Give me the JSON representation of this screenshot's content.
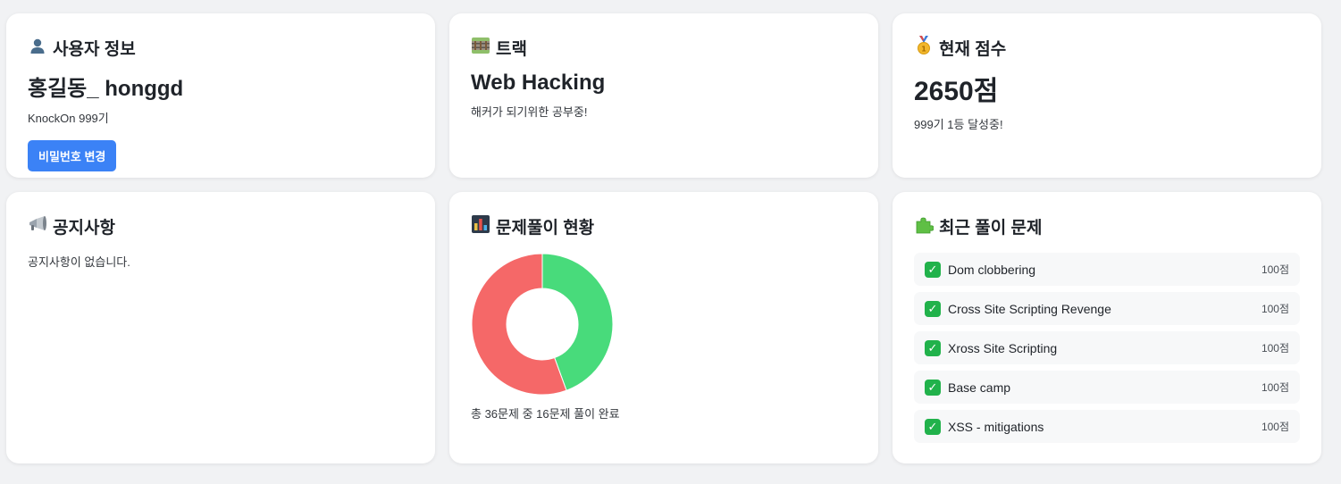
{
  "user_card": {
    "icon": "user-icon",
    "title": "사용자 정보",
    "name": "홍길동_ honggd",
    "generation": "KnockOn 999기",
    "change_password_label": "비밀번호 변경",
    "accent_color": "#3b82f6"
  },
  "track_card": {
    "icon": "railway-track-icon",
    "title": "트랙",
    "track": "Web Hacking",
    "description": "해커가 되기위한 공부중!"
  },
  "score_card": {
    "icon": "medal-icon",
    "title": "현재 점수",
    "score": "2650점",
    "rank_text": "999기 1등 달성중!"
  },
  "notice_card": {
    "icon": "megaphone-icon",
    "title": "공지사항",
    "empty_text": "공지사항이 없습니다."
  },
  "progress_card": {
    "icon": "bar-chart-icon",
    "title": "문제풀이 현황",
    "caption": "총 36문제 중 16문제 풀이 완료"
  },
  "chart_data": {
    "type": "pie",
    "donut": true,
    "categories": [
      "solved",
      "unsolved"
    ],
    "values": [
      16,
      20
    ],
    "colors": [
      "#48db7b",
      "#f56868"
    ]
  },
  "recent_card": {
    "icon": "puzzle-icon",
    "title": "최근 풀이 문제",
    "check_icon": "check-icon",
    "check_color": "#21b24b",
    "items": [
      {
        "title": "Dom clobbering",
        "score": "100점"
      },
      {
        "title": "Cross Site Scripting Revenge",
        "score": "100점"
      },
      {
        "title": "Xross Site Scripting",
        "score": "100점"
      },
      {
        "title": "Base camp",
        "score": "100점"
      },
      {
        "title": "XSS - mitigations",
        "score": "100점"
      }
    ]
  }
}
